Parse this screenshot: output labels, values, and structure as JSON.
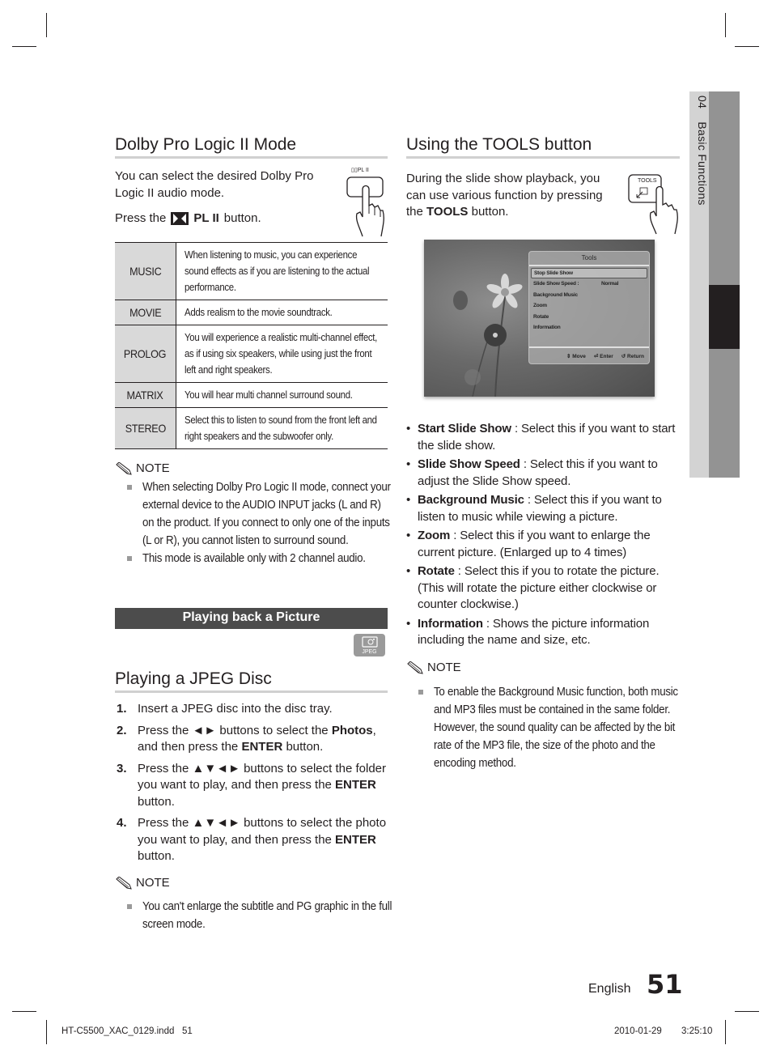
{
  "side_tab": {
    "chapter_number": "04",
    "chapter_title": "Basic Functions"
  },
  "dolby": {
    "title": "Dolby Pro Logic II Mode",
    "intro": "You can select the desired Dolby Pro Logic II audio mode.",
    "press_prefix": "Press the",
    "press_button": "PL II",
    "press_suffix": "button.",
    "remote_label": "PL II",
    "modes": [
      {
        "mode": "MUSIC",
        "description": "When listening to music, you can experience sound effects as if you are listening to the actual performance."
      },
      {
        "mode": "MOVIE",
        "description": "Adds realism to the movie soundtrack."
      },
      {
        "mode": "PROLOG",
        "description": "You will experience a realistic multi-channel effect, as if using six speakers, while using just the front left and right speakers."
      },
      {
        "mode": "MATRIX",
        "description": "You will hear multi channel surround sound."
      },
      {
        "mode": "STEREO",
        "description": "Select this to listen to sound from the front left and right speakers and the subwoofer only."
      }
    ],
    "note_label": "NOTE",
    "notes": [
      "When selecting Dolby Pro Logic II mode, connect your external device to the AUDIO INPUT jacks (L and R) on the product. If you connect to only one of the inputs (L or R), you cannot listen to surround sound.",
      "This mode is available only with 2 channel audio."
    ]
  },
  "picture_section": {
    "bar_title": "Playing back a Picture",
    "badge_label": "JPEG"
  },
  "jpeg": {
    "title": "Playing a JPEG Disc",
    "steps": [
      {
        "num": "1.",
        "parts": [
          {
            "t": "Insert a JPEG disc into the disc tray.",
            "b": false
          }
        ]
      },
      {
        "num": "2.",
        "parts": [
          {
            "t": "Press the ◄► buttons to select the ",
            "b": false
          },
          {
            "t": "Photos",
            "b": true
          },
          {
            "t": ", and then press the ",
            "b": false
          },
          {
            "t": "ENTER",
            "b": true
          },
          {
            "t": " button.",
            "b": false
          }
        ]
      },
      {
        "num": "3.",
        "parts": [
          {
            "t": "Press the ▲▼◄► buttons to select the folder you want to play, and then press the ",
            "b": false
          },
          {
            "t": "ENTER",
            "b": true
          },
          {
            "t": " button.",
            "b": false
          }
        ]
      },
      {
        "num": "4.",
        "parts": [
          {
            "t": "Press the ▲▼◄► buttons to select the photo you want to play, and then press the ",
            "b": false
          },
          {
            "t": "ENTER",
            "b": true
          },
          {
            "t": " button.",
            "b": false
          }
        ]
      }
    ],
    "note_label": "NOTE",
    "notes": [
      "You can't enlarge the subtitle and PG graphic in the full screen mode."
    ]
  },
  "tools": {
    "title": "Using the TOOLS button",
    "intro_prefix": "During the slide show playback, you can use various function by pressing the ",
    "intro_bold": "TOOLS",
    "intro_suffix": " button.",
    "remote_label": "TOOLS",
    "menu": {
      "title": "Tools",
      "items": [
        {
          "label": "Stop Slide Show",
          "value": "",
          "selected": true
        },
        {
          "label": "Slide Show Speed :",
          "value": "Normal",
          "selected": false
        },
        {
          "label": "Background Music",
          "value": "",
          "selected": false
        },
        {
          "label": "Zoom",
          "value": "",
          "selected": false
        },
        {
          "label": "Rotate",
          "value": "",
          "selected": false
        },
        {
          "label": "Information",
          "value": "",
          "selected": false
        }
      ],
      "footer": {
        "move": "Move",
        "enter": "Enter",
        "return": "Return"
      }
    },
    "bullets": [
      {
        "term": "Start Slide Show",
        "text": " : Select this if you want to start the slide show."
      },
      {
        "term": "Slide Show Speed",
        "text": " : Select this if you want to adjust the Slide Show speed."
      },
      {
        "term": "Background Music",
        "text": " : Select this if you want to listen to music while viewing a picture."
      },
      {
        "term": "Zoom",
        "text": " : Select this if you want to enlarge the current picture. (Enlarged up to 4 times)"
      },
      {
        "term": "Rotate",
        "text": " : Select this if you to rotate the picture. (This will rotate the picture either clockwise or counter clockwise.)"
      },
      {
        "term": "Information",
        "text": " : Shows the picture information including the name and size, etc."
      }
    ],
    "note_label": "NOTE",
    "notes": [
      "To enable the Background Music function, both music and MP3 files must be contained in the same folder. However, the sound quality can be affected by the bit rate of the MP3 file, the size of the photo and the encoding method."
    ]
  },
  "page_footer": {
    "language": "English",
    "page_number": "51",
    "file_info": "HT-C5500_XAC_0129.indd   51",
    "date": "2010-01-29",
    "time": "3:25:10"
  }
}
